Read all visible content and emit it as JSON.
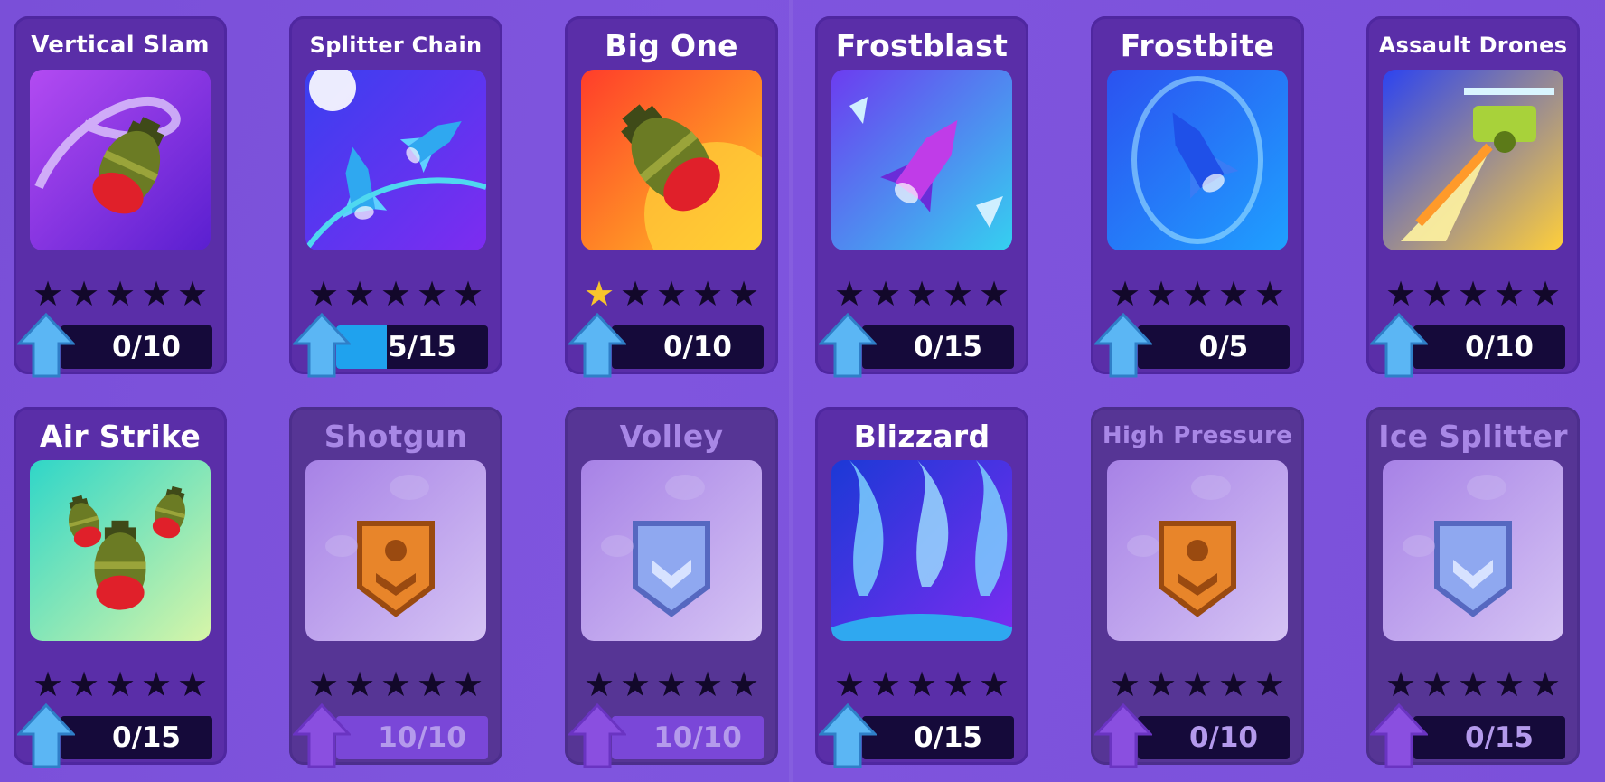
{
  "colors": {
    "star_on": "#f7c42c",
    "star_off": "#12082a",
    "progress_fill": "#1fa2ee",
    "arrow_active": "#5bb6f4",
    "arrow_locked": "#8a4fe0"
  },
  "cards": [
    {
      "title": "Vertical Slam",
      "icon": "bomb-icon",
      "stars": 0,
      "progress_text": "0/10",
      "progress": 0.0,
      "locked": false,
      "theme": "purple"
    },
    {
      "title": "Splitter Chain",
      "icon": "splitting-rocket-icon",
      "stars": 0,
      "progress_text": "5/15",
      "progress": 0.333,
      "locked": false,
      "theme": "blue"
    },
    {
      "title": "Big One",
      "icon": "big-bomb-icon",
      "stars": 1,
      "progress_text": "0/10",
      "progress": 0.0,
      "locked": false,
      "theme": "red"
    },
    {
      "title": "Frostblast",
      "icon": "ice-rocket-icon",
      "stars": 0,
      "progress_text": "0/15",
      "progress": 0.0,
      "locked": false,
      "theme": "ice"
    },
    {
      "title": "Frostbite",
      "icon": "frozen-rocket-icon",
      "stars": 0,
      "progress_text": "0/5",
      "progress": 0.0,
      "locked": false,
      "theme": "deepblue"
    },
    {
      "title": "Assault Drones",
      "icon": "drone-icon",
      "stars": 0,
      "progress_text": "0/10",
      "progress": 0.0,
      "locked": false,
      "theme": "drone"
    },
    {
      "title": "Air Strike",
      "icon": "bombs-icon",
      "stars": 0,
      "progress_text": "0/15",
      "progress": 0.0,
      "locked": false,
      "theme": "green"
    },
    {
      "title": "Shotgun",
      "icon": "bronze-badge-icon",
      "stars": 0,
      "progress_text": "10/10",
      "progress": 1.0,
      "locked": true,
      "theme": "locked-bronze"
    },
    {
      "title": "Volley",
      "icon": "silver-badge-icon",
      "stars": 0,
      "progress_text": "10/10",
      "progress": 1.0,
      "locked": true,
      "theme": "locked-silver"
    },
    {
      "title": "Blizzard",
      "icon": "blue-flames-icon",
      "stars": 0,
      "progress_text": "0/15",
      "progress": 0.0,
      "locked": false,
      "theme": "blizzard"
    },
    {
      "title": "High Pressure",
      "icon": "bronze-badge-icon",
      "stars": 0,
      "progress_text": "0/10",
      "progress": 0.0,
      "locked": true,
      "theme": "locked-bronze"
    },
    {
      "title": "Ice Splitter",
      "icon": "silver-badge-icon",
      "stars": 0,
      "progress_text": "0/15",
      "progress": 0.0,
      "locked": true,
      "theme": "locked-silver"
    }
  ]
}
